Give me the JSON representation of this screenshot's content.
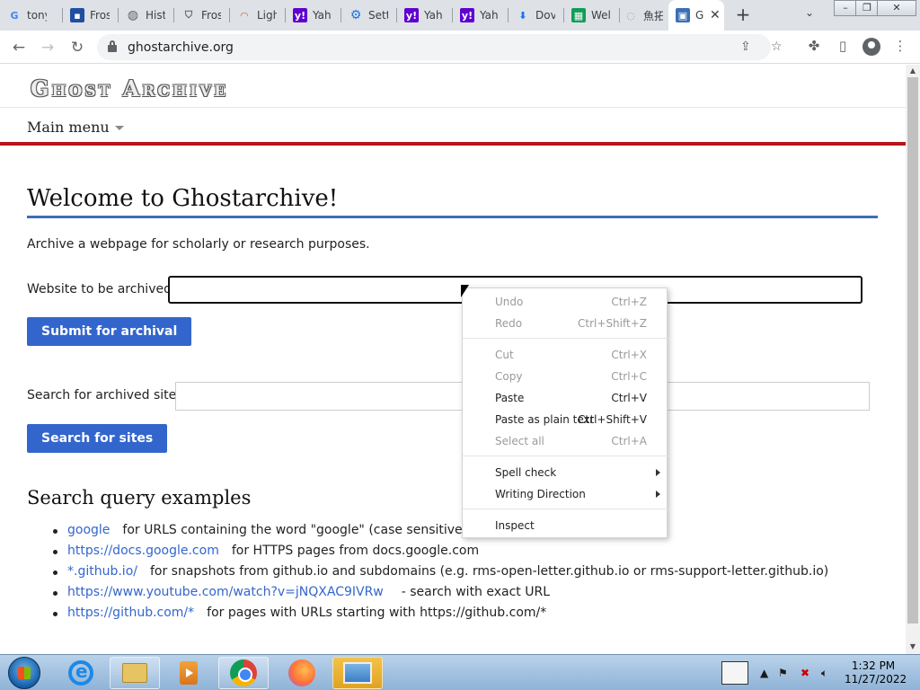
{
  "browser": {
    "tabs": [
      {
        "label": "tony",
        "icon": "google-icon"
      },
      {
        "label": "Fros",
        "icon": "book-icon"
      },
      {
        "label": "Hist",
        "icon": "globe-icon"
      },
      {
        "label": "Fros",
        "icon": "shirt-icon"
      },
      {
        "label": "Ligh",
        "icon": "rainbow-icon"
      },
      {
        "label": "Yah",
        "icon": "yahoo-icon"
      },
      {
        "label": "Sett",
        "icon": "settings-gear-icon"
      },
      {
        "label": "Yah",
        "icon": "yahoo-icon"
      },
      {
        "label": "Yah",
        "icon": "yahoo-icon"
      },
      {
        "label": "Dov",
        "icon": "download-icon"
      },
      {
        "label": "Wel",
        "icon": "sheet-icon"
      },
      {
        "label": "魚拓",
        "icon": "loading-icon"
      },
      {
        "label": "G",
        "icon": "ghost-archive-icon"
      }
    ],
    "url": "ghostarchive.org"
  },
  "page": {
    "logo_text": "Ghost Archive",
    "main_menu": "Main menu",
    "title": "Welcome to Ghostarchive!",
    "intro": "Archive a webpage for scholarly or research purposes.",
    "archive_label": "Website to be archived:",
    "archive_value": "",
    "submit_button": "Submit for archival",
    "search_label": "Search for archived sites:",
    "search_value": "",
    "search_button": "Search for sites",
    "examples_title": "Search query examples",
    "examples": [
      {
        "query": "google",
        "description": "for URLS containing the word \"google\" (case sensitive)"
      },
      {
        "query": "https://docs.google.com",
        "description": "for HTTPS pages from docs.google.com"
      },
      {
        "query": "*.github.io/",
        "description": "for snapshots from github.io and subdomains (e.g. rms-open-letter.github.io or rms-support-letter.github.io)"
      },
      {
        "query": "https://www.youtube.com/watch?v=jNQXAC9IVRw",
        "description": "- search with exact URL"
      },
      {
        "query": "https://github.com/*",
        "description": "for pages with URLs starting with https://github.com/*"
      }
    ]
  },
  "context_menu": {
    "items": [
      {
        "label": "Undo",
        "shortcut": "Ctrl+Z",
        "enabled": false
      },
      {
        "label": "Redo",
        "shortcut": "Ctrl+Shift+Z",
        "enabled": false
      },
      {
        "label": "Cut",
        "shortcut": "Ctrl+X",
        "enabled": false
      },
      {
        "label": "Copy",
        "shortcut": "Ctrl+C",
        "enabled": false
      },
      {
        "label": "Paste",
        "shortcut": "Ctrl+V",
        "enabled": true
      },
      {
        "label": "Paste as plain text",
        "shortcut": "Ctrl+Shift+V",
        "enabled": true
      },
      {
        "label": "Select all",
        "shortcut": "Ctrl+A",
        "enabled": false
      },
      {
        "label": "Spell check",
        "shortcut": "",
        "enabled": true,
        "submenu": true
      },
      {
        "label": "Writing Direction",
        "shortcut": "",
        "enabled": true,
        "submenu": true
      },
      {
        "label": "Inspect",
        "shortcut": "",
        "enabled": true
      }
    ]
  },
  "taskbar": {
    "clock_time": "1:32 PM",
    "clock_date": "11/27/2022"
  },
  "colors": {
    "accent_button": "#3366cc",
    "header_bar": "#b5151b",
    "title_rule": "#3a6fb6",
    "link": "#3366cc"
  }
}
